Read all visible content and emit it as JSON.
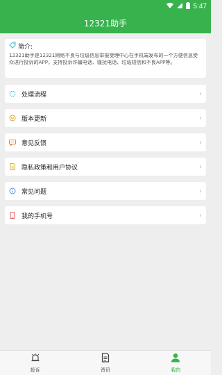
{
  "status": {
    "time": "5:47",
    "icons": [
      "wifi-icon",
      "signal-icon",
      "battery-icon"
    ]
  },
  "app": {
    "title": "12321助手",
    "accent": "#37b24d"
  },
  "intro": {
    "title": "简介:",
    "text": "12321助手是12321网络不良与垃圾信息举报受理中心在手机端发布的一个方便信息受众进行投诉的APP，支持投诉诈骗电话、骚扰电话、垃圾短信和不良APP等。"
  },
  "menu": [
    {
      "label": "处理流程",
      "icon": "process-icon",
      "color": "#3fb8c9"
    },
    {
      "label": "版本更新",
      "icon": "update-icon",
      "color": "#e0a52b"
    },
    {
      "label": "意见反馈",
      "icon": "feedback-icon",
      "color": "#e8833a"
    },
    {
      "label": "隐私政策和用户协议",
      "icon": "privacy-icon",
      "color": "#d9b62c"
    },
    {
      "label": "常见问题",
      "icon": "faq-icon",
      "color": "#5b8fd6"
    },
    {
      "label": "我的手机号",
      "icon": "phone-icon",
      "color": "#e05a5a"
    }
  ],
  "tabs": [
    {
      "label": "投诉",
      "icon": "alarm-icon",
      "active": false
    },
    {
      "label": "资讯",
      "icon": "news-icon",
      "active": false
    },
    {
      "label": "我的",
      "icon": "person-icon",
      "active": true
    }
  ]
}
